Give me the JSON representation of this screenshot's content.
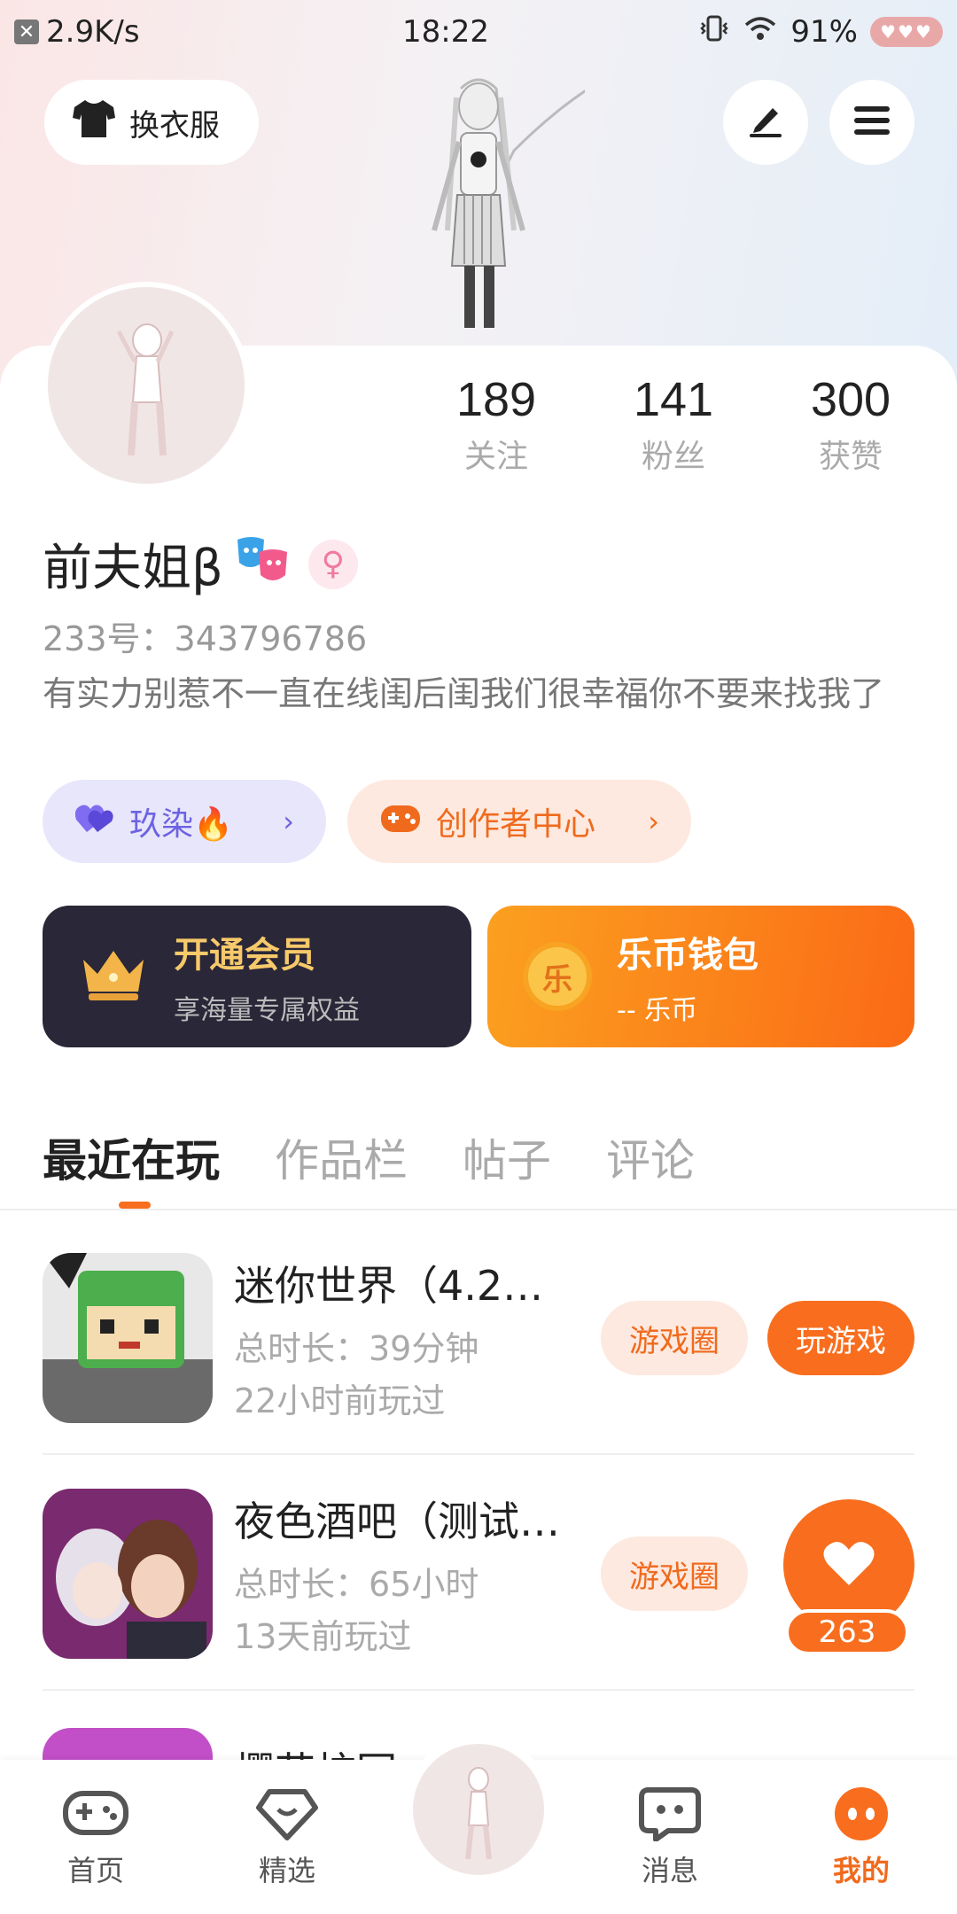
{
  "status_bar": {
    "speed": "2.9K/s",
    "time": "18:22",
    "battery": "91%"
  },
  "header": {
    "outfit_label": "换衣服"
  },
  "stats": [
    {
      "num": "189",
      "label": "关注"
    },
    {
      "num": "141",
      "label": "粉丝"
    },
    {
      "num": "300",
      "label": "获赞"
    }
  ],
  "profile": {
    "name": "前夫姐β",
    "gender_symbol": "♀",
    "id_line": "233号：343796786",
    "bio": "有实力别惹不一直在线闺后闺我们很幸福你不要来找我了"
  },
  "chips": {
    "partner": "玖染🔥",
    "creator": "创作者中心",
    "chevron": "›"
  },
  "vip": {
    "title": "开通会员",
    "sub": "享海量专属权益"
  },
  "wallet": {
    "title": "乐币钱包",
    "sub": "-- 乐币",
    "coin": "乐"
  },
  "tabs": [
    "最近在玩",
    "作品栏",
    "帖子",
    "评论"
  ],
  "games": [
    {
      "title": "迷你世界（4.2…",
      "duration": "总时长：39分钟",
      "last": "22小时前玩过",
      "circle_btn": "游戏圈",
      "play_btn": "玩游戏"
    },
    {
      "title": "夜色酒吧（测试…",
      "duration": "总时长：65小时",
      "last": "13天前玩过",
      "circle_btn": "游戏圈"
    }
  ],
  "partial_game_title": "樱花校园",
  "like_count": "263",
  "nav": [
    {
      "label": "首页",
      "icon": "gamepad-icon"
    },
    {
      "label": "精选",
      "icon": "heart-diamond-icon"
    },
    {
      "label": "消息",
      "icon": "chat-icon"
    },
    {
      "label": "我的",
      "icon": "profile-face-icon"
    }
  ],
  "colors": {
    "accent": "#f86e1e",
    "purple": "#6d62e3",
    "vip_gold": "#f6c96a",
    "dark": "#2a2738"
  }
}
